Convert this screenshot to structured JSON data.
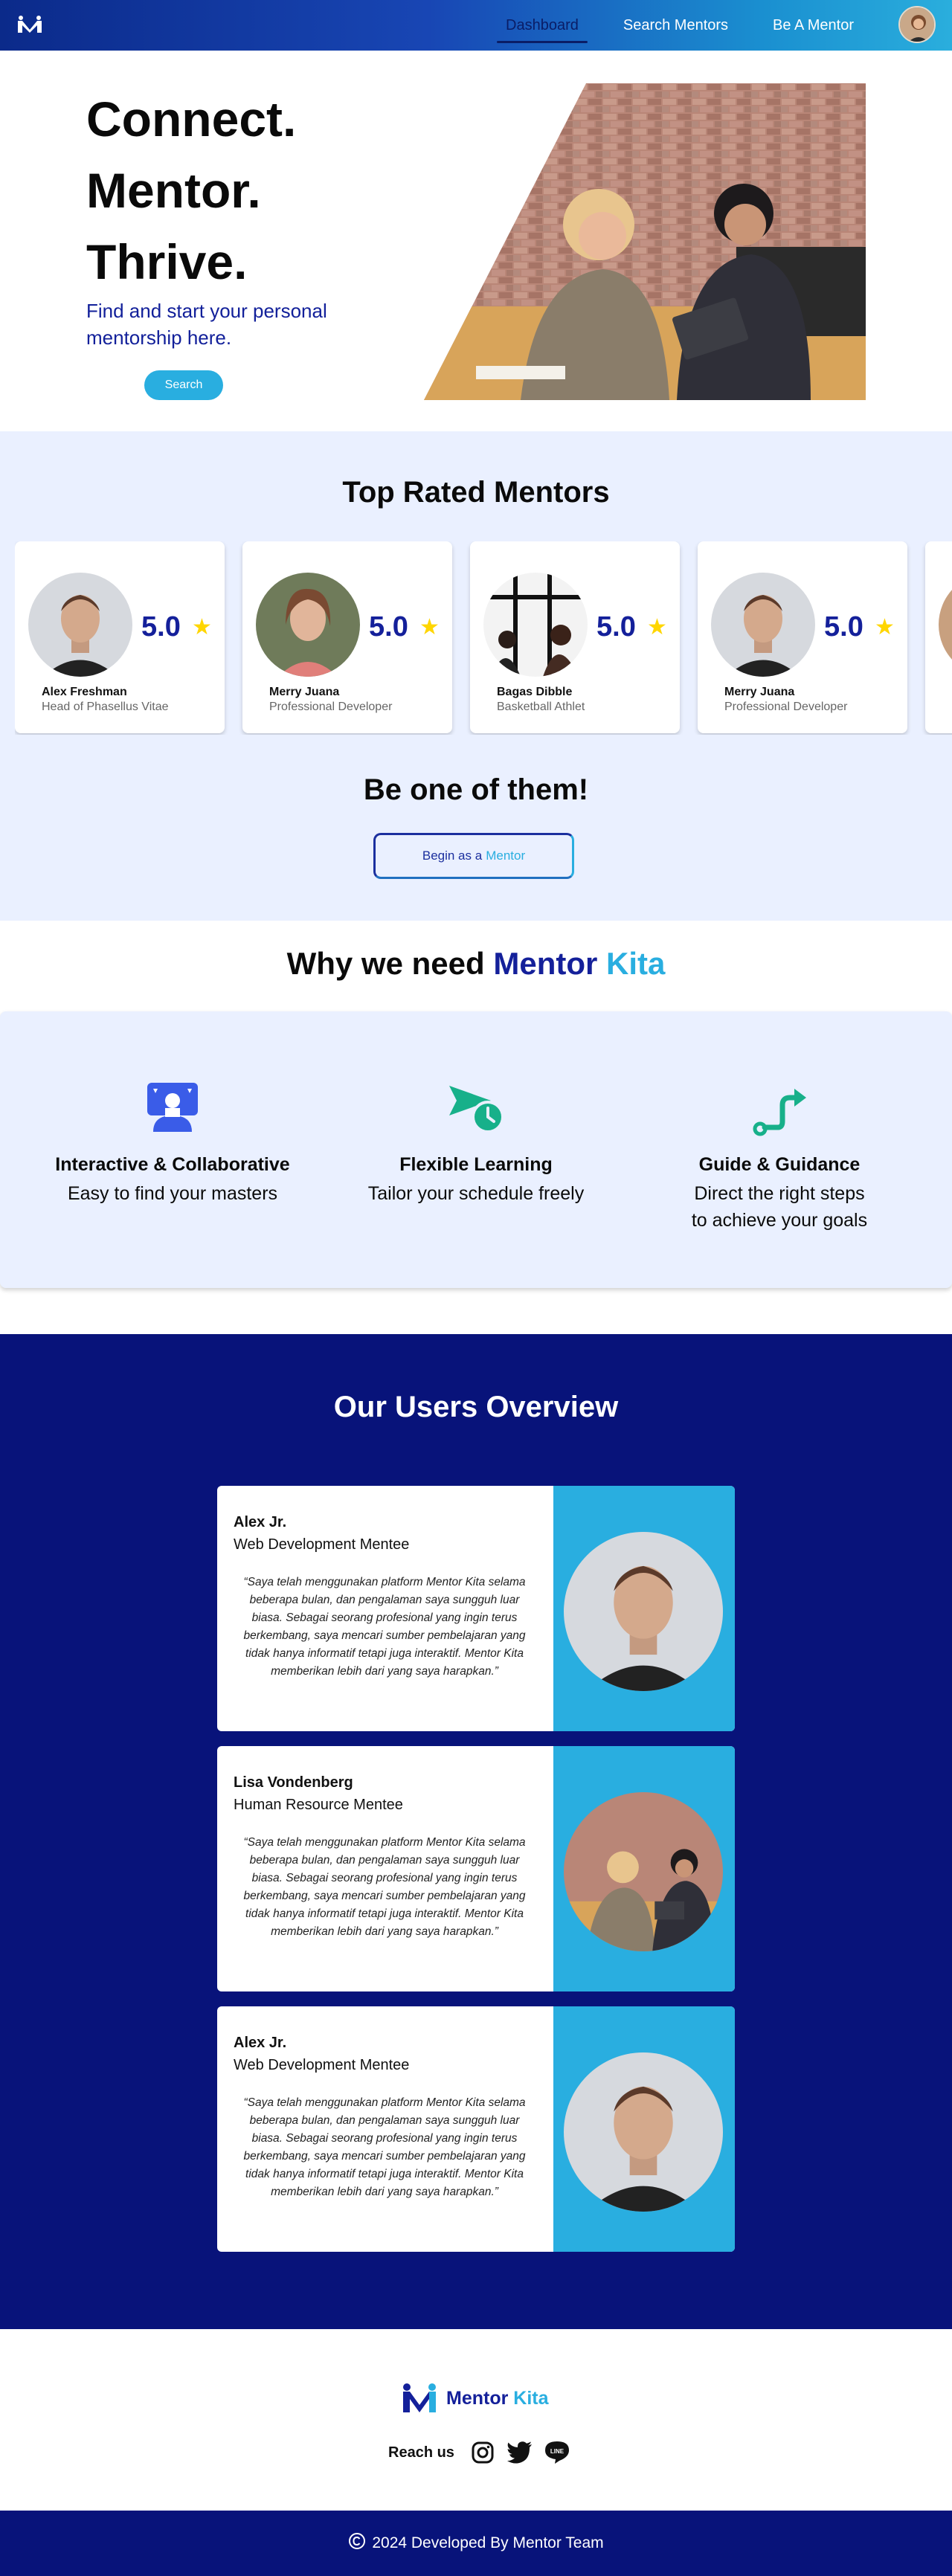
{
  "nav": {
    "links": [
      "Dashboard",
      "Search Mentors",
      "Be A Mentor"
    ],
    "active": "Dashboard"
  },
  "hero": {
    "title_lines": [
      "Connect.",
      "Mentor.",
      "Thrive."
    ],
    "subtitle": "Find and start your personal mentorship here.",
    "search_label": "Search"
  },
  "top_rated": {
    "title": "Top Rated Mentors",
    "mentors": [
      {
        "name": "Alex Freshman",
        "role": "Head of Phasellus Vitae",
        "rating": "5.0"
      },
      {
        "name": "Merry Juana",
        "role": "Professional Developer",
        "rating": "5.0"
      },
      {
        "name": "Bagas Dibble",
        "role": "Basketball Athlet",
        "rating": "5.0"
      },
      {
        "name": "Merry Juana",
        "role": "Professional Developer",
        "rating": "5.0"
      }
    ],
    "cta_title": "Be one of them!",
    "cta_label_a": "Begin as a",
    "cta_label_b": "Mentor"
  },
  "why": {
    "title_a": "Why we need",
    "title_b": "Mentor",
    "title_c": "Kita",
    "features": [
      {
        "icon": "presentation-icon",
        "title": "Interactive & Collaborative",
        "desc": "Easy to find your masters"
      },
      {
        "icon": "paper-plane-clock-icon",
        "title": "Flexible Learning",
        "desc": "Tailor your schedule freely"
      },
      {
        "icon": "route-arrow-icon",
        "title": "Guide & Guidance",
        "desc": "Direct the right steps\nto achieve your goals"
      }
    ],
    "colors": {
      "presentation": "#3a5ce8",
      "plane": "#17b08a",
      "route": "#17b08a"
    }
  },
  "overview": {
    "title": "Our Users Overview",
    "reviews": [
      {
        "name": "Alex Jr.",
        "role": "Web Development Mentee",
        "quote": "“Saya telah menggunakan platform Mentor Kita selama beberapa bulan, dan  pengalaman saya sungguh luar biasa. Sebagai seorang profesional yang  ingin terus berkembang, saya mencari sumber pembelajaran yang tidak  hanya informatif tetapi juga interaktif. Mentor Kita memberikan lebih  dari yang saya harapkan.”"
      },
      {
        "name": "Lisa Vondenberg",
        "role": "Human Resource Mentee",
        "quote": "“Saya telah menggunakan platform Mentor Kita selama beberapa bulan, dan  pengalaman saya sungguh luar biasa. Sebagai seorang profesional yang  ingin terus berkembang, saya mencari sumber pembelajaran yang tidak  hanya informatif tetapi juga interaktif. Mentor Kita memberikan lebih  dari yang saya harapkan.”"
      },
      {
        "name": "Alex Jr.",
        "role": "Web Development Mentee",
        "quote": "“Saya telah menggunakan platform Mentor Kita selama beberapa bulan, dan  pengalaman saya sungguh luar biasa. Sebagai seorang profesional yang  ingin terus berkembang, saya mencari sumber pembelajaran yang tidak  hanya informatif tetapi juga interaktif. Mentor Kita memberikan lebih  dari yang saya harapkan.”"
      }
    ]
  },
  "footer": {
    "brand_a": "Mentor",
    "brand_b": "Kita",
    "reach_label": "Reach us",
    "socials": [
      "instagram-icon",
      "twitter-icon",
      "line-icon"
    ],
    "line_text": "LINE",
    "copyright": "2024 Developed By Mentor Team"
  },
  "colors": {
    "primary": "#14209a",
    "accent": "#29aee0",
    "navy": "#08137a",
    "panel": "#eaf0ff",
    "star": "#ffd600"
  }
}
